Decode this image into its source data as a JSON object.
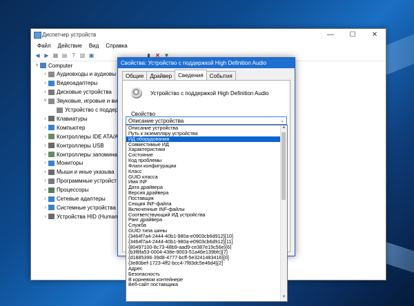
{
  "device_manager": {
    "title": "Диспетчер устройств",
    "menu": [
      "Файл",
      "Действие",
      "Вид",
      "Справка"
    ],
    "tree": [
      {
        "label": "Computer",
        "level": 0,
        "expander": "˅",
        "icon_color": "#4a7fc1"
      },
      {
        "label": "Аудиовходы и аудиовы",
        "level": 1,
        "expander": "›",
        "icon_color": "#8a8a8a"
      },
      {
        "label": "Видеоадаптеры",
        "level": 1,
        "expander": "›",
        "icon_color": "#3b83c9"
      },
      {
        "label": "Дисковые устройства",
        "level": 1,
        "expander": "›",
        "icon_color": "#7a7a7a"
      },
      {
        "label": "Звуковые, игровые и виде",
        "level": 1,
        "expander": "˅",
        "icon_color": "#8a8a8a"
      },
      {
        "label": "Устройство с поддер",
        "level": 2,
        "expander": "",
        "icon_color": "#8a8a8a"
      },
      {
        "label": "Клавиатуры",
        "level": 1,
        "expander": "›",
        "icon_color": "#6a6a6a"
      },
      {
        "label": "Компьютер",
        "level": 1,
        "expander": "›",
        "icon_color": "#3b83c9"
      },
      {
        "label": "Контроллеры IDE ATA/A",
        "level": 1,
        "expander": "›",
        "icon_color": "#6a8a6a"
      },
      {
        "label": "Контроллеры USB",
        "level": 1,
        "expander": "›",
        "icon_color": "#6a6a6a"
      },
      {
        "label": "Контроллеры запомина",
        "level": 1,
        "expander": "›",
        "icon_color": "#6a8a6a"
      },
      {
        "label": "Мониторы",
        "level": 1,
        "expander": "›",
        "icon_color": "#3b83c9"
      },
      {
        "label": "Мыши и иные указыва",
        "level": 1,
        "expander": "›",
        "icon_color": "#6a6a6a"
      },
      {
        "label": "Программные устройст",
        "level": 1,
        "expander": "›",
        "icon_color": "#7a7a7a"
      },
      {
        "label": "Процессоры",
        "level": 1,
        "expander": "›",
        "icon_color": "#5a7a5a"
      },
      {
        "label": "Сетевые адаптеры",
        "level": 1,
        "expander": "›",
        "icon_color": "#3b83c9"
      },
      {
        "label": "Системные устройства",
        "level": 1,
        "expander": "›",
        "icon_color": "#3b83c9"
      },
      {
        "label": "Устройства HID (Human",
        "level": 1,
        "expander": "›",
        "icon_color": "#6a6a6a"
      }
    ]
  },
  "dialog": {
    "title": "Свойства: Устройство с поддержкой High Definition Audio",
    "tabs": [
      {
        "label": "Общие",
        "active": false
      },
      {
        "label": "Драйвер",
        "active": false
      },
      {
        "label": "Сведения",
        "active": true
      },
      {
        "label": "События",
        "active": false
      }
    ],
    "device_name": "Устройство с поддержкой High Definition Audio",
    "property_label": "Свойство",
    "selected_value": "Описание устройства",
    "options": [
      "Описание устройства",
      "Путь к экземпляру устройства",
      "ИД оборудования",
      "Совместимые ИД",
      "Характеристики",
      "Состояние",
      "Код проблемы",
      "Флаги конфигурации",
      "Класс",
      "GUID класса",
      "Имя INF",
      "Дата драйвера",
      "Версия драйвера",
      "Поставщик",
      "Секция INF-файла",
      "Включенные INF-файлы",
      "Соответствующий ИД устройства",
      "Ранг драйвера",
      "Служба",
      "GUID типа шины",
      "{3464f7a4-2444-40b1-980a-e0903cb6d912}[10]",
      "{3464f7a4-2444-40b1-980a-e0903cb6d912}[11]",
      "{80497100-8c73-48b9-aad9-ce387e19c56e}[6]",
      "{b3f8fa53-0004-438e-9003-51a46e139bfc}[7]",
      "{d1885396-39d8-4777-bcff-5e3241483416}[0]",
      "{3e80bef-1723-4ff2-bcc4-7f83dc5e46d4}[2]",
      "Адрес",
      "Безопасность",
      "В корневом контейнере",
      "Веб-сайт поставщика"
    ],
    "highlighted_index": 2
  }
}
